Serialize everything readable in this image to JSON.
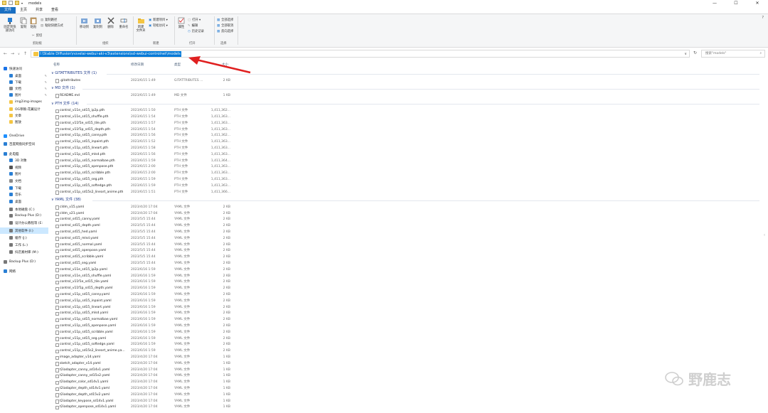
{
  "window": {
    "title": "models",
    "minimize": "—",
    "maximize": "☐",
    "close": "✕"
  },
  "tabs": [
    "文件",
    "主页",
    "共享",
    "查看"
  ],
  "ribbon": {
    "pin": "固定到快\n速访问",
    "copy": "复制",
    "paste": "粘贴",
    "cut": "剪切",
    "copy_path": "复制路径",
    "paste_shortcut": "粘贴快捷方式",
    "clipboard": "剪贴板",
    "move_to": "移动到",
    "copy_to": "复制到",
    "delete": "删除",
    "rename": "重命名",
    "organize": "组织",
    "new_folder": "新建\n文件夹",
    "new_item": "新建项目 ▾",
    "easy_access": "轻松访问 ▾",
    "new": "新建",
    "properties": "属性",
    "open_menu": "打开 ▾",
    "edit": "编辑",
    "history": "历史记录",
    "open": "打开",
    "select_all": "全部选择",
    "select_none": "全部取消",
    "invert": "反向选择",
    "select": "选择"
  },
  "address": {
    "path": "I:\\Stable Diffusion\\novelai-webui-aki-v3\\extensions\\sd-webui-controlnet\\models",
    "search_placeholder": "搜索\"models\""
  },
  "nav": [
    {
      "label": "快速访问",
      "indent": 0,
      "color": "#1a73e8",
      "pin": false
    },
    {
      "label": "桌面",
      "indent": 1,
      "color": "#2a7fd4",
      "pin": true
    },
    {
      "label": "下载",
      "indent": 1,
      "color": "#2a7fd4",
      "pin": true
    },
    {
      "label": "文档",
      "indent": 1,
      "color": "#8a8a8a",
      "pin": true
    },
    {
      "label": "图片",
      "indent": 1,
      "color": "#2a7fd4",
      "pin": true
    },
    {
      "label": "img2img-images",
      "indent": 1,
      "color": "#f4c542",
      "pin": false
    },
    {
      "label": "OG草稿-花翼设计",
      "indent": 1,
      "color": "#f4c542",
      "pin": false
    },
    {
      "label": "文章",
      "indent": 1,
      "color": "#f4c542",
      "pin": false
    },
    {
      "label": "图放",
      "indent": 1,
      "color": "#f4c542",
      "pin": false
    },
    {
      "label": "OneDrive",
      "indent": 0,
      "color": "#1e90ff",
      "pin": false
    },
    {
      "label": "百度网盘同步空间",
      "indent": 0,
      "color": "#2a7fd4",
      "pin": false
    },
    {
      "label": "此电脑",
      "indent": 0,
      "color": "#2a7fd4",
      "pin": false
    },
    {
      "label": "3D 对象",
      "indent": 1,
      "color": "#2a7fd4",
      "pin": false
    },
    {
      "label": "视频",
      "indent": 1,
      "color": "#555555",
      "pin": false
    },
    {
      "label": "图片",
      "indent": 1,
      "color": "#2a7fd4",
      "pin": false
    },
    {
      "label": "文档",
      "indent": 1,
      "color": "#8a8a8a",
      "pin": false
    },
    {
      "label": "下载",
      "indent": 1,
      "color": "#2a7fd4",
      "pin": false
    },
    {
      "label": "音乐",
      "indent": 1,
      "color": "#2a7fd4",
      "pin": false
    },
    {
      "label": "桌面",
      "indent": 1,
      "color": "#2a7fd4",
      "pin": false
    },
    {
      "label": "本地磁盘 (C:)",
      "indent": 1,
      "color": "#777777",
      "pin": false
    },
    {
      "label": "Backup Plus (D:)",
      "indent": 1,
      "color": "#777777",
      "pin": false
    },
    {
      "label": "设计办公教程等 (E:",
      "indent": 1,
      "color": "#777777",
      "pin": false
    },
    {
      "label": "其他软件 (I:)",
      "indent": 1,
      "color": "#777777",
      "pin": false,
      "selected": true
    },
    {
      "label": "缓存 (J:)",
      "indent": 1,
      "color": "#777777",
      "pin": false
    },
    {
      "label": "工作 (L:)",
      "indent": 1,
      "color": "#777777",
      "pin": false
    },
    {
      "label": "抖店素材库 (M:)",
      "indent": 1,
      "color": "#777777",
      "pin": false
    },
    {
      "label": "Backup Plus (D:)",
      "indent": 0,
      "color": "#777777",
      "pin": false
    },
    {
      "label": "网络",
      "indent": 0,
      "color": "#2a7fd4",
      "pin": false
    }
  ],
  "columns": {
    "name": "名称",
    "date": "修改日期",
    "type": "类型",
    "size": "大小"
  },
  "groups": [
    {
      "label": "GITATTRIBUTES 文件 (1)",
      "files": [
        [
          ".gitattributes",
          "2023/6/15 1:49",
          "GITATTRIBUTES ...",
          "2 KB"
        ]
      ]
    },
    {
      "label": "MD 文件 (1)",
      "files": [
        [
          "README.md",
          "2023/6/15 1:49",
          "MD 文件",
          "1 KB"
        ]
      ]
    },
    {
      "label": "PTH 文件 (14)",
      "files": [
        [
          "control_v11e_sd15_ip2p.pth",
          "2023/6/15 1:50",
          "PTH 文件",
          "1,411,362..."
        ],
        [
          "control_v11e_sd15_shuffle.pth",
          "2023/6/15 1:54",
          "PTH 文件",
          "1,411,363..."
        ],
        [
          "control_v11f1e_sd15_tile.pth",
          "2023/6/15 1:57",
          "PTH 文件",
          "1,411,363..."
        ],
        [
          "control_v11f1p_sd15_depth.pth",
          "2023/6/15 1:54",
          "PTH 文件",
          "1,411,363..."
        ],
        [
          "control_v11p_sd15_canny.pth",
          "2023/6/15 1:56",
          "PTH 文件",
          "1,411,362..."
        ],
        [
          "control_v11p_sd15_inpaint.pth",
          "2023/6/15 1:52",
          "PTH 文件",
          "1,411,363..."
        ],
        [
          "control_v11p_sd15_lineart.pth",
          "2023/6/15 1:58",
          "PTH 文件",
          "1,411,363..."
        ],
        [
          "control_v11p_sd15_mlsd.pth",
          "2023/6/15 1:56",
          "PTH 文件",
          "1,411,363..."
        ],
        [
          "control_v11p_sd15_normalbae.pth",
          "2023/6/15 1:59",
          "PTH 文件",
          "1,411,364..."
        ],
        [
          "control_v11p_sd15_openpose.pth",
          "2023/6/15 2:00",
          "PTH 文件",
          "1,411,363..."
        ],
        [
          "control_v11p_sd15_scribble.pth",
          "2023/6/15 2:00",
          "PTH 文件",
          "1,411,363..."
        ],
        [
          "control_v11p_sd15_seg.pth",
          "2023/6/15 1:59",
          "PTH 文件",
          "1,411,363..."
        ],
        [
          "control_v11p_sd15_softedge.pth",
          "2023/6/15 1:59",
          "PTH 文件",
          "1,411,363..."
        ],
        [
          "control_v11p_sd15s2_lineart_anime.pth",
          "2023/6/15 1:51",
          "PTH 文件",
          "1,411,366..."
        ]
      ]
    },
    {
      "label": "YAML 文件 (38)",
      "files": [
        [
          "cldm_v15.yaml",
          "2023/4/20 17:04",
          "YAML 文件",
          "2 KB"
        ],
        [
          "cldm_v21.yaml",
          "2023/4/20 17:04",
          "YAML 文件",
          "2 KB"
        ],
        [
          "control_sd15_canny.yaml",
          "2023/5/5 15:44",
          "YAML 文件",
          "2 KB"
        ],
        [
          "control_sd15_depth.yaml",
          "2023/5/5 15:44",
          "YAML 文件",
          "2 KB"
        ],
        [
          "control_sd15_hed.yaml",
          "2023/5/5 15:44",
          "YAML 文件",
          "2 KB"
        ],
        [
          "control_sd15_mlsd.yaml",
          "2023/5/5 15:44",
          "YAML 文件",
          "2 KB"
        ],
        [
          "control_sd15_normal.yaml",
          "2023/5/5 15:44",
          "YAML 文件",
          "2 KB"
        ],
        [
          "control_sd15_openpose.yaml",
          "2023/5/5 15:44",
          "YAML 文件",
          "2 KB"
        ],
        [
          "control_sd15_scribble.yaml",
          "2023/5/5 15:44",
          "YAML 文件",
          "2 KB"
        ],
        [
          "control_sd15_seg.yaml",
          "2023/5/5 15:44",
          "YAML 文件",
          "2 KB"
        ],
        [
          "control_v11e_sd15_ip2p.yaml",
          "2023/6/16 1:59",
          "YAML 文件",
          "2 KB"
        ],
        [
          "control_v11e_sd15_shuffle.yaml",
          "2023/6/16 1:59",
          "YAML 文件",
          "2 KB"
        ],
        [
          "control_v11f1e_sd15_tile.yaml",
          "2023/6/16 1:59",
          "YAML 文件",
          "2 KB"
        ],
        [
          "control_v11f1p_sd15_depth.yaml",
          "2023/6/16 1:59",
          "YAML 文件",
          "2 KB"
        ],
        [
          "control_v11p_sd15_canny.yaml",
          "2023/6/16 1:59",
          "YAML 文件",
          "2 KB"
        ],
        [
          "control_v11p_sd15_inpaint.yaml",
          "2023/6/16 1:59",
          "YAML 文件",
          "2 KB"
        ],
        [
          "control_v11p_sd15_lineart.yaml",
          "2023/6/16 1:59",
          "YAML 文件",
          "2 KB"
        ],
        [
          "control_v11p_sd15_mlsd.yaml",
          "2023/6/16 1:59",
          "YAML 文件",
          "2 KB"
        ],
        [
          "control_v11p_sd15_normalbae.yaml",
          "2023/6/16 1:59",
          "YAML 文件",
          "2 KB"
        ],
        [
          "control_v11p_sd15_openpose.yaml",
          "2023/6/16 1:59",
          "YAML 文件",
          "2 KB"
        ],
        [
          "control_v11p_sd15_scribble.yaml",
          "2023/6/16 1:59",
          "YAML 文件",
          "2 KB"
        ],
        [
          "control_v11p_sd15_seg.yaml",
          "2023/6/16 1:59",
          "YAML 文件",
          "2 KB"
        ],
        [
          "control_v11p_sd15_softedge.yaml",
          "2023/6/16 1:59",
          "YAML 文件",
          "2 KB"
        ],
        [
          "control_v11p_sd15s2_lineart_anime.ya...",
          "2023/6/16 1:59",
          "YAML 文件",
          "2 KB"
        ],
        [
          "image_adapter_v14.yaml",
          "2023/4/20 17:04",
          "YAML 文件",
          "1 KB"
        ],
        [
          "sketch_adapter_v14.yaml",
          "2023/4/20 17:04",
          "YAML 文件",
          "1 KB"
        ],
        [
          "t2iadapter_canny_sd14v1.yaml",
          "2023/4/20 17:04",
          "YAML 文件",
          "1 KB"
        ],
        [
          "t2iadapter_canny_sd15v2.yaml",
          "2023/4/20 17:04",
          "YAML 文件",
          "1 KB"
        ],
        [
          "t2iadapter_color_sd14v1.yaml",
          "2023/4/20 17:04",
          "YAML 文件",
          "1 KB"
        ],
        [
          "t2iadapter_depth_sd14v1.yaml",
          "2023/4/20 17:04",
          "YAML 文件",
          "1 KB"
        ],
        [
          "t2iadapter_depth_sd15v2.yaml",
          "2023/4/20 17:04",
          "YAML 文件",
          "1 KB"
        ],
        [
          "t2iadapter_keypose_sd14v1.yaml",
          "2023/4/20 17:04",
          "YAML 文件",
          "1 KB"
        ],
        [
          "t2iadapter_openpose_sd14v1.yaml",
          "2023/4/20 17:04",
          "YAML 文件",
          "1 KB"
        ]
      ]
    }
  ],
  "watermark": "野鹿志",
  "colors": {
    "accent": "#1a6fc2",
    "selection": "#0078d7",
    "arrow": "#e02020",
    "nav_selected": "#cce8ff"
  }
}
